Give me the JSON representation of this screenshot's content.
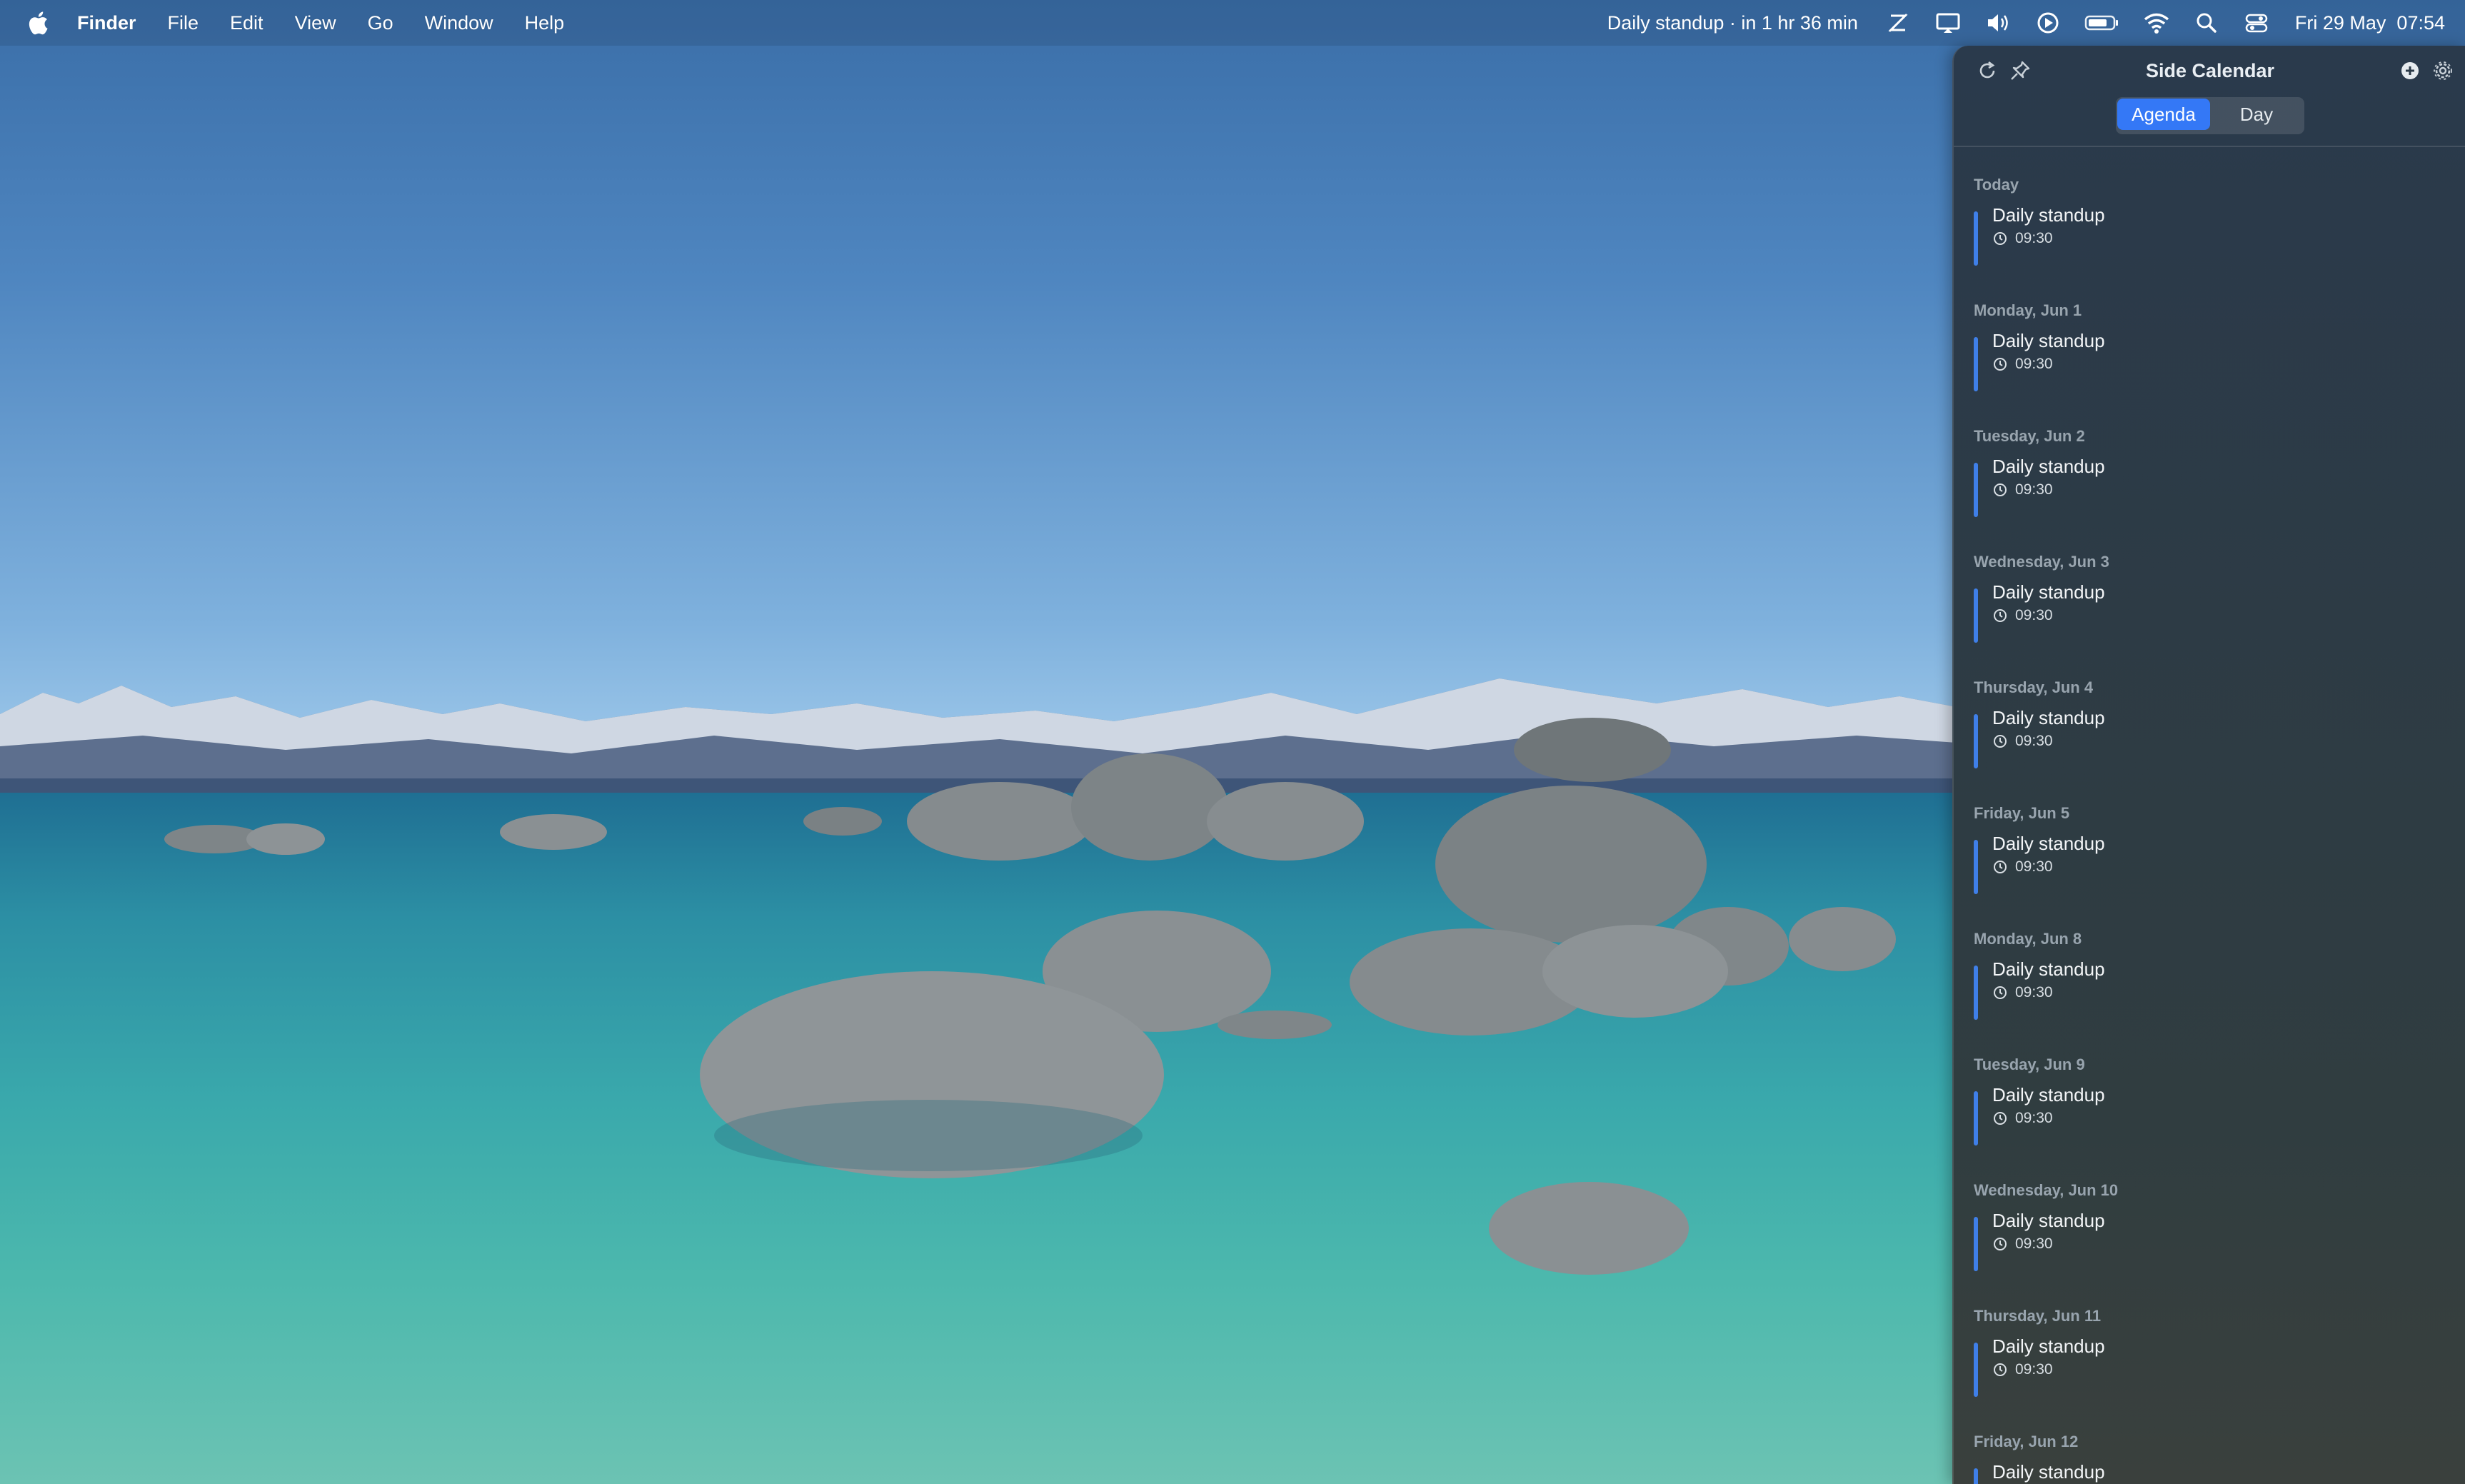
{
  "menubar": {
    "app_name": "Finder",
    "menus": [
      "File",
      "Edit",
      "View",
      "Go",
      "Window",
      "Help"
    ],
    "status_text": "Daily standup · in 1 hr 36 min",
    "clock": "Fri 29 May  07:54",
    "tray_icons": [
      "amphetamine-icon",
      "display-icon",
      "volume-icon",
      "play-icon",
      "battery-icon",
      "wifi-icon",
      "spotlight-search-icon",
      "control-center-icon"
    ]
  },
  "panel": {
    "title": "Side Calendar",
    "tabs": [
      {
        "label": "Agenda",
        "active": true
      },
      {
        "label": "Day",
        "active": false
      }
    ],
    "accent_color": "#3478f6",
    "event_bar_color": "#3f7fe8",
    "days": [
      {
        "label": "Today",
        "events": [
          {
            "title": "Daily standup",
            "time": "09:30"
          }
        ]
      },
      {
        "label": "Monday, Jun 1",
        "events": [
          {
            "title": "Daily standup",
            "time": "09:30"
          }
        ]
      },
      {
        "label": "Tuesday, Jun 2",
        "events": [
          {
            "title": "Daily standup",
            "time": "09:30"
          }
        ]
      },
      {
        "label": "Wednesday, Jun 3",
        "events": [
          {
            "title": "Daily standup",
            "time": "09:30"
          }
        ]
      },
      {
        "label": "Thursday, Jun 4",
        "events": [
          {
            "title": "Daily standup",
            "time": "09:30"
          }
        ]
      },
      {
        "label": "Friday, Jun 5",
        "events": [
          {
            "title": "Daily standup",
            "time": "09:30"
          }
        ]
      },
      {
        "label": "Monday, Jun 8",
        "events": [
          {
            "title": "Daily standup",
            "time": "09:30"
          }
        ]
      },
      {
        "label": "Tuesday, Jun 9",
        "events": [
          {
            "title": "Daily standup",
            "time": "09:30"
          }
        ]
      },
      {
        "label": "Wednesday, Jun 10",
        "events": [
          {
            "title": "Daily standup",
            "time": "09:30"
          }
        ]
      },
      {
        "label": "Thursday, Jun 11",
        "events": [
          {
            "title": "Daily standup",
            "time": "09:30"
          }
        ]
      },
      {
        "label": "Friday, Jun 12",
        "events": [
          {
            "title": "Daily standup",
            "time": ""
          }
        ]
      }
    ]
  }
}
